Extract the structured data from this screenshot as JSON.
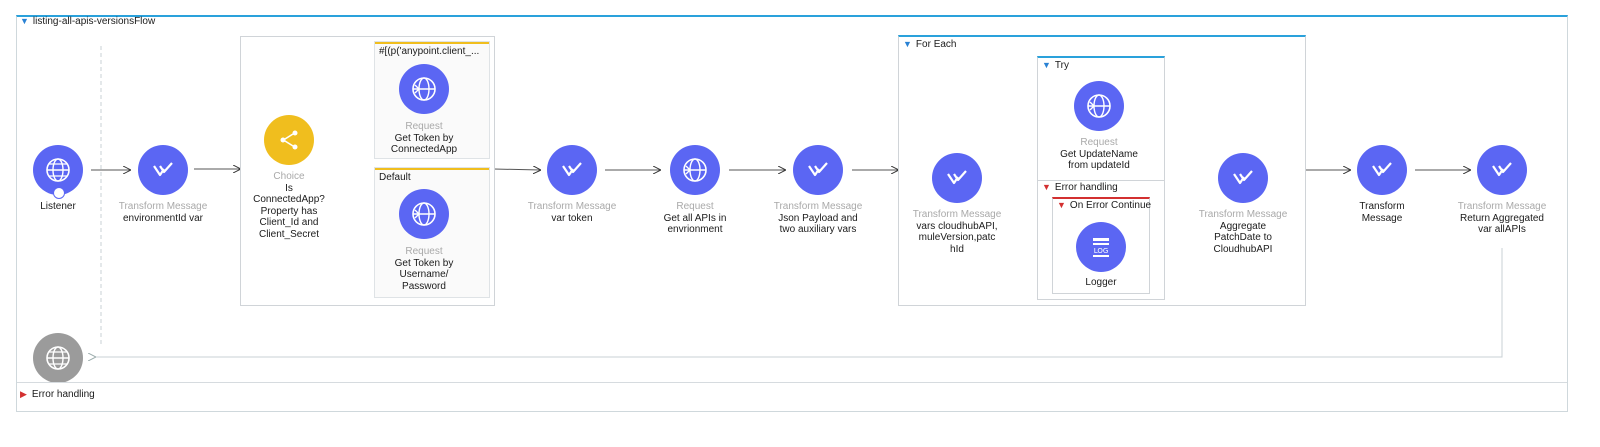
{
  "flow": {
    "title": "listing-all-apis-versionsFlow",
    "error_handling": "Error handling"
  },
  "nodes": {
    "listener": {
      "type": "",
      "name": "Listener"
    },
    "tm_env": {
      "type": "Transform Message",
      "name": "environmentId var"
    },
    "choice": {
      "type": "Choice",
      "name": "Is ConnectedApp? Property has Client_Id and Client_Secret"
    },
    "route1_label": "#[(p('anypoint.client_...",
    "req_connapp": {
      "type": "Request",
      "name": "Get Token by ConnectedApp"
    },
    "route2_label": "Default",
    "req_userpass": {
      "type": "Request",
      "name": "Get Token by Username/ Password"
    },
    "tm_token": {
      "type": "Transform Message",
      "name": "var token"
    },
    "req_allapis": {
      "type": "Request",
      "name": "Get all APIs in envrionment"
    },
    "tm_json": {
      "type": "Transform Message",
      "name": "Json Payload and two auxiliary vars"
    },
    "foreach_title": "For Each",
    "tm_vars": {
      "type": "Transform Message",
      "name": "vars cloudhubAPI,muleVersion,patchId"
    },
    "try_title": "Try",
    "req_update": {
      "type": "Request",
      "name": "Get UpdateName from updateId"
    },
    "try_error_handling": "Error handling",
    "on_error_continue": "On Error Continue",
    "logger": {
      "type": "",
      "name": "Logger"
    },
    "tm_aggregate": {
      "type": "Transform Message",
      "name": "Aggregate PatchDate to CloudhubAPI"
    },
    "tm_plain": {
      "type": "",
      "name": "Transform Message"
    },
    "tm_return": {
      "type": "Transform Message",
      "name": "Return Aggregated var allAPIs"
    }
  },
  "icons": {
    "http": "globe-icon",
    "transform": "dataweave-check-icon",
    "choice": "branch-icon",
    "logger": "log-icon"
  },
  "colors": {
    "node": "#5b66f3",
    "choice": "#f0be1e",
    "source_response": "#9b9b9b",
    "flow_border": "#2aa1db",
    "error": "#d33030"
  }
}
